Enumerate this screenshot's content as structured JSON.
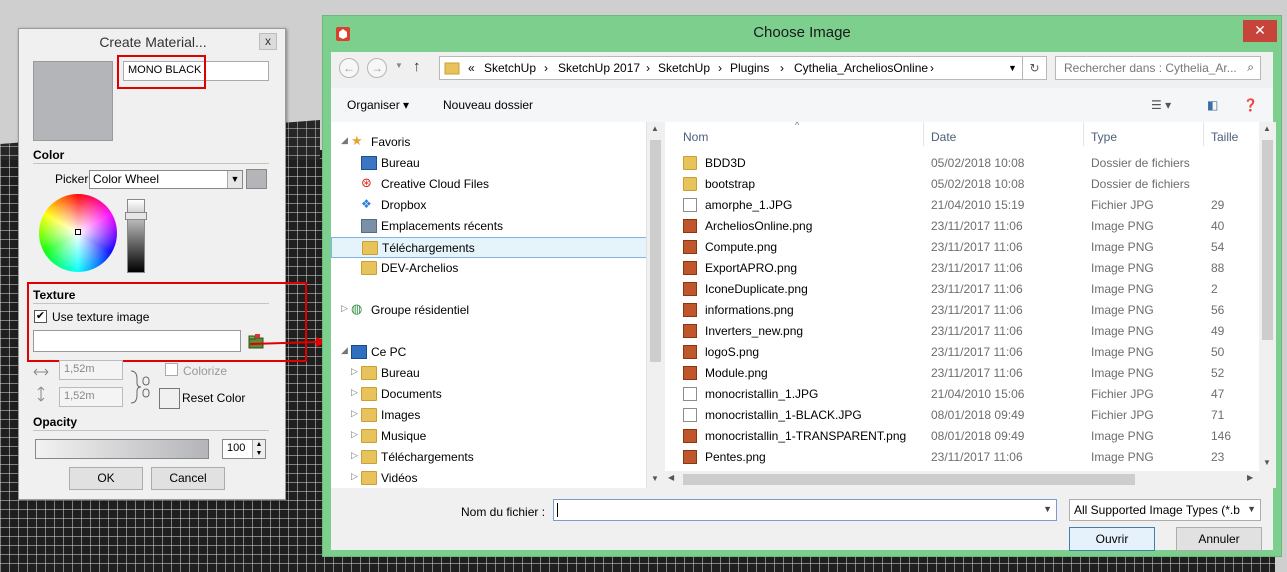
{
  "create_material": {
    "title": "Create Material...",
    "close": "x",
    "name_value": "MONO BLACK",
    "color_section": "Color",
    "picker_label": "Picker:",
    "picker_value": "Color Wheel",
    "texture_section": "Texture",
    "use_texture_label": "Use texture image",
    "use_texture_checked": true,
    "width_value": "1,52m",
    "height_value": "1,52m",
    "colorize_label": "Colorize",
    "reset_color_label": "Reset Color",
    "opacity_section": "Opacity",
    "opacity_value": "100",
    "ok_label": "OK",
    "cancel_label": "Cancel",
    "swatch_color": "#b4b5b8"
  },
  "choose_image": {
    "title": "Choose Image",
    "address_prefix": "«",
    "breadcrumb": [
      "SketchUp",
      "SketchUp 2017",
      "SketchUp",
      "Plugins",
      "Cythelia_ArcheliosOnline"
    ],
    "search_placeholder": "Rechercher dans : Cythelia_Ar...",
    "toolbar": {
      "organise": "Organiser ▾",
      "new_folder": "Nouveau dossier"
    },
    "nav": {
      "favorites": "Favoris",
      "favorites_items": [
        "Bureau",
        "Creative Cloud Files",
        "Dropbox",
        "Emplacements récents",
        "Téléchargements",
        "DEV-Archelios"
      ],
      "homegroup": "Groupe résidentiel",
      "this_pc": "Ce PC",
      "pc_items": [
        "Bureau",
        "Documents",
        "Images",
        "Musique",
        "Téléchargements",
        "Vidéos"
      ]
    },
    "columns": {
      "name": "Nom",
      "date": "Date",
      "type": "Type",
      "size": "Taille"
    },
    "files": [
      {
        "name": "BDD3D",
        "date": "05/02/2018 10:08",
        "type": "Dossier de fichiers",
        "size": "",
        "kind": "folder"
      },
      {
        "name": "bootstrap",
        "date": "05/02/2018 10:08",
        "type": "Dossier de fichiers",
        "size": "",
        "kind": "folder"
      },
      {
        "name": "amorphe_1.JPG",
        "date": "21/04/2010 15:19",
        "type": "Fichier JPG",
        "size": "29",
        "kind": "jpg"
      },
      {
        "name": "ArcheliosOnline.png",
        "date": "23/11/2017 11:06",
        "type": "Image PNG",
        "size": "40",
        "kind": "png"
      },
      {
        "name": "Compute.png",
        "date": "23/11/2017 11:06",
        "type": "Image PNG",
        "size": "54",
        "kind": "png"
      },
      {
        "name": "ExportAPRO.png",
        "date": "23/11/2017 11:06",
        "type": "Image PNG",
        "size": "88",
        "kind": "png"
      },
      {
        "name": "IconeDuplicate.png",
        "date": "23/11/2017 11:06",
        "type": "Image PNG",
        "size": "2",
        "kind": "png"
      },
      {
        "name": "informations.png",
        "date": "23/11/2017 11:06",
        "type": "Image PNG",
        "size": "56",
        "kind": "png"
      },
      {
        "name": "Inverters_new.png",
        "date": "23/11/2017 11:06",
        "type": "Image PNG",
        "size": "49",
        "kind": "png"
      },
      {
        "name": "logoS.png",
        "date": "23/11/2017 11:06",
        "type": "Image PNG",
        "size": "50",
        "kind": "png"
      },
      {
        "name": "Module.png",
        "date": "23/11/2017 11:06",
        "type": "Image PNG",
        "size": "52",
        "kind": "png"
      },
      {
        "name": "monocristallin_1.JPG",
        "date": "21/04/2010 15:06",
        "type": "Fichier JPG",
        "size": "47",
        "kind": "jpg"
      },
      {
        "name": "monocristallin_1-BLACK.JPG",
        "date": "08/01/2018 09:49",
        "type": "Fichier JPG",
        "size": "71",
        "kind": "jpg"
      },
      {
        "name": "monocristallin_1-TRANSPARENT.png",
        "date": "08/01/2018 09:49",
        "type": "Image PNG",
        "size": "146",
        "kind": "png"
      },
      {
        "name": "Pentes.png",
        "date": "23/11/2017 11:06",
        "type": "Image PNG",
        "size": "23",
        "kind": "png"
      }
    ],
    "filename_label": "Nom du fichier :",
    "filename_value": "",
    "filetype_value": "All Supported Image Types (*.b",
    "open_label": "Ouvrir",
    "cancel_label": "Annuler",
    "accent_color": "#7ccf8c"
  }
}
